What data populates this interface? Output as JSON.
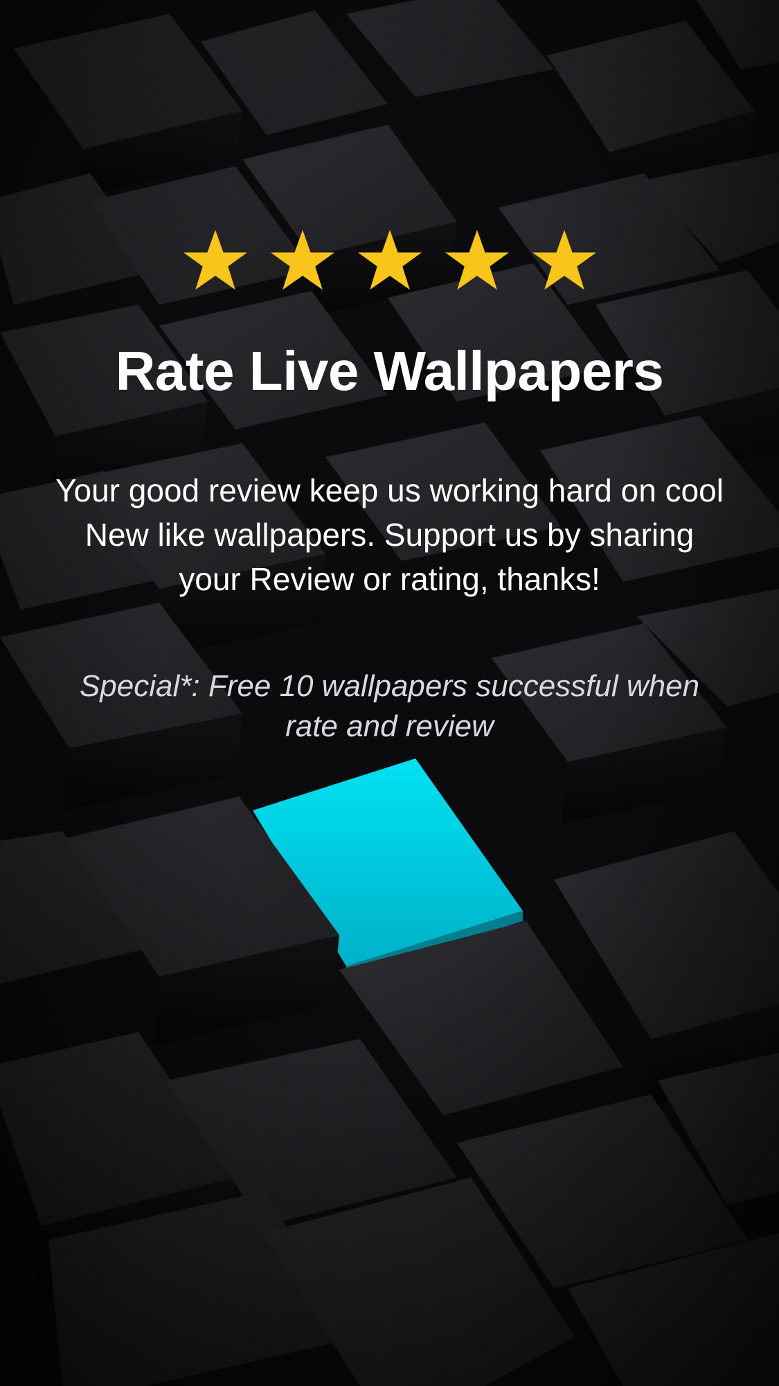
{
  "rating": {
    "stars": 5,
    "star_color": "#F9C51A",
    "icon": "star-icon"
  },
  "title": "Rate Live Wallpapers",
  "body": "Your good review keep us working hard on cool New like wallpapers. Support us by sharing your Review or rating, thanks!",
  "special": "Special*: Free 10 wallpapers successful when rate and review",
  "colors": {
    "background": "#1c1c1f",
    "accent_tile": "#00C8DE",
    "text": "#FFFFFF"
  }
}
